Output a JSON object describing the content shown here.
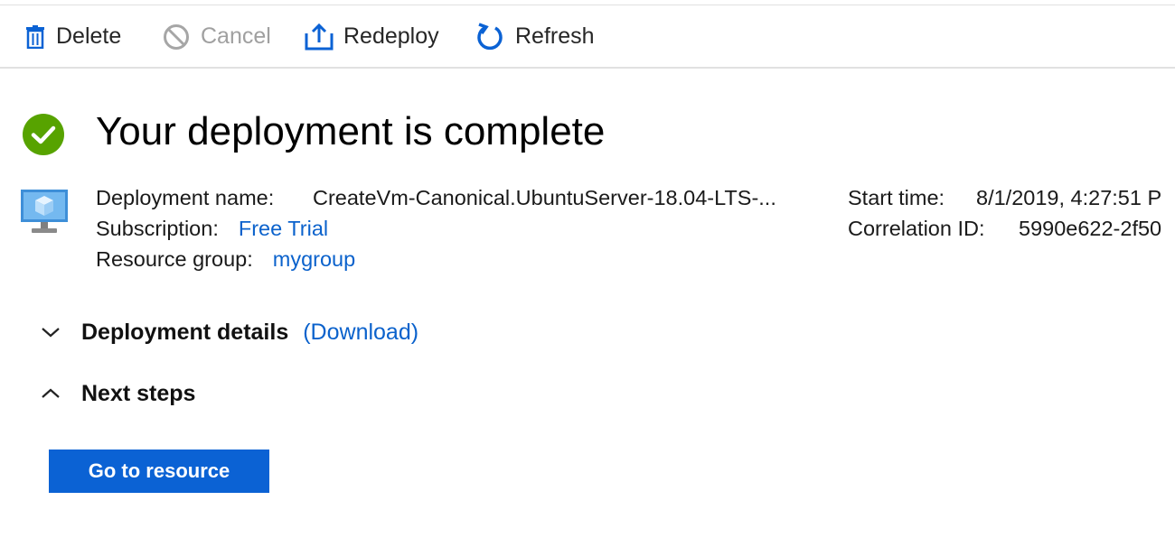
{
  "toolbar": {
    "delete_label": "Delete",
    "cancel_label": "Cancel",
    "redeploy_label": "Redeploy",
    "refresh_label": "Refresh"
  },
  "status": {
    "title": "Your deployment is complete",
    "icon": "check-circle-icon",
    "color": "#57a300"
  },
  "details": {
    "deployment_name_label": "Deployment name:",
    "deployment_name_value": "CreateVm-Canonical.UbuntuServer-18.04-LTS-...",
    "subscription_label": "Subscription:",
    "subscription_value": "Free Trial",
    "resource_group_label": "Resource group:",
    "resource_group_value": "mygroup",
    "start_time_label": "Start time:",
    "start_time_value": "8/1/2019, 4:27:51 P",
    "correlation_id_label": "Correlation ID:",
    "correlation_id_value": "5990e622-2f50"
  },
  "sections": {
    "deployment_details": "Deployment details",
    "download_link": "(Download)",
    "next_steps": "Next steps"
  },
  "primary_button": "Go to resource",
  "colors": {
    "link": "#0b62cc",
    "accent": "#0b62d4",
    "success": "#57a300"
  }
}
